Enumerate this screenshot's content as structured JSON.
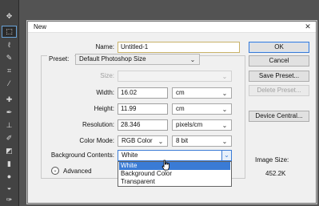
{
  "dialog": {
    "title": "New",
    "close_glyph": "✕"
  },
  "fields": {
    "name_label": "Name:",
    "name_value": "Untitled-1",
    "preset_label": "Preset:",
    "preset_value": "Default Photoshop Size",
    "size_label": "Size:",
    "size_value": "",
    "width_label": "Width:",
    "width_value": "16.02",
    "width_unit": "cm",
    "height_label": "Height:",
    "height_value": "11.99",
    "height_unit": "cm",
    "resolution_label": "Resolution:",
    "resolution_value": "28.346",
    "resolution_unit": "pixels/cm",
    "color_mode_label": "Color Mode:",
    "color_mode_value": "RGB Color",
    "bit_depth_value": "8 bit",
    "background_label": "Background Contents:",
    "background_value": "White",
    "advanced_label": "Advanced"
  },
  "background_options": [
    "White",
    "Background Color",
    "Transparent"
  ],
  "buttons": {
    "ok": "OK",
    "cancel": "Cancel",
    "save_preset": "Save Preset...",
    "delete_preset": "Delete Preset...",
    "device_central": "Device Central..."
  },
  "image_size": {
    "label": "Image Size:",
    "value": "452.2K"
  },
  "toolbar_tools": [
    "move-tool",
    "marquee-tool",
    "lasso-tool",
    "quick-selection-tool",
    "crop-tool",
    "eyedropper-tool",
    "healing-brush-tool",
    "brush-tool",
    "clone-stamp-tool",
    "history-brush-tool",
    "eraser-tool",
    "gradient-tool",
    "blur-tool",
    "dodge-tool",
    "pen-tool"
  ],
  "colors": {
    "accent": "#3a7bd5",
    "workspace": "#535353",
    "dialog_bg": "#f0f0f0"
  }
}
